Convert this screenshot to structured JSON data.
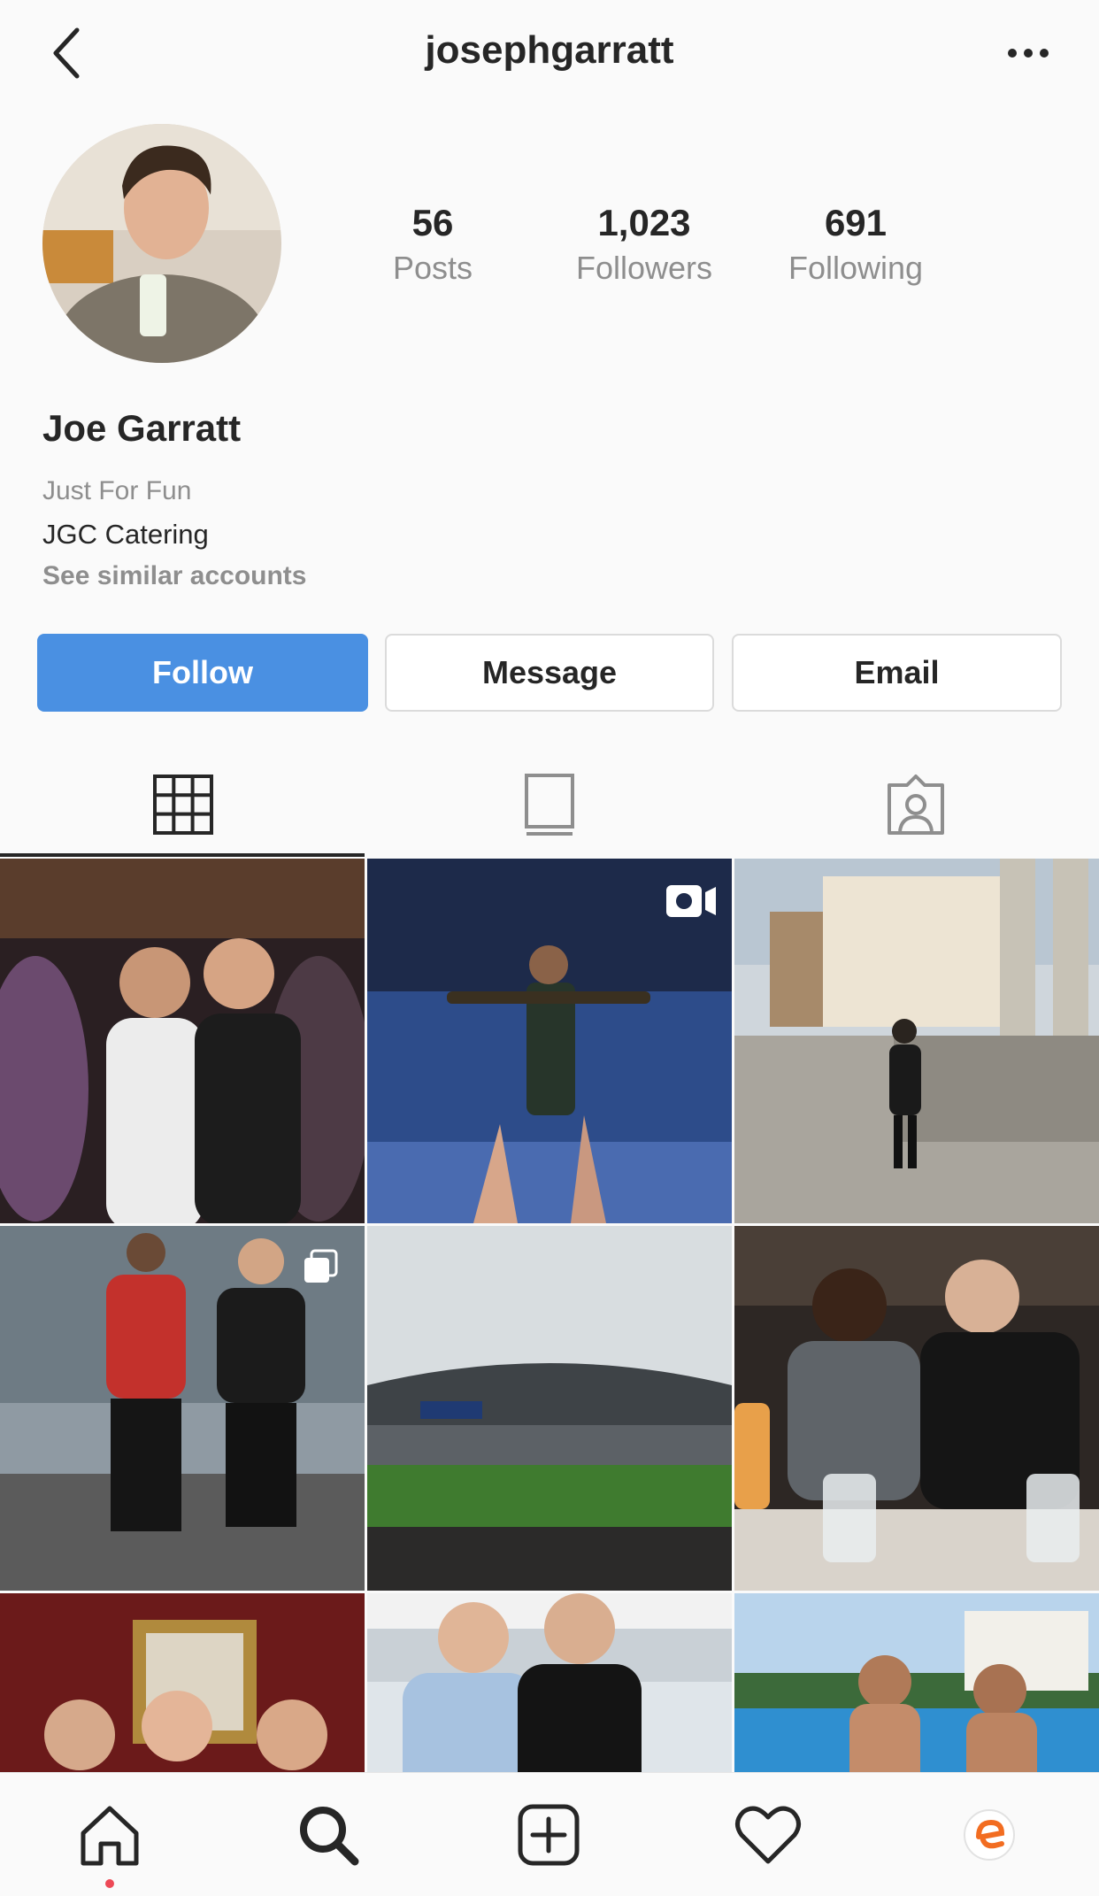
{
  "header": {
    "username": "josephgarratt"
  },
  "stats": [
    {
      "count": "56",
      "label": "Posts"
    },
    {
      "count": "1,023",
      "label": "Followers"
    },
    {
      "count": "691",
      "label": "Following"
    }
  ],
  "profile": {
    "name": "Joe Garratt",
    "category": "Just For Fun",
    "bio": "JGC Catering",
    "similar_link": "See similar accounts"
  },
  "actions": {
    "follow": "Follow",
    "message": "Message",
    "email": "Email"
  },
  "tabs": [
    "grid-icon",
    "igtv-icon",
    "tagged-icon"
  ],
  "colors": {
    "follow_button": "#4a90e2",
    "notification_dot": "#ed4956",
    "secondary_text": "#8e8e8e"
  },
  "posts": [
    {
      "description": "two men posing in a crowded bar",
      "video": false
    },
    {
      "description": "performer on a lit concert stage",
      "video": true
    },
    {
      "description": "woman walking past stone columns in a city square",
      "video": false
    },
    {
      "description": "two men by a fountain",
      "video": false,
      "multiple": true
    },
    {
      "description": "view of a rugby stadium",
      "video": false
    },
    {
      "description": "two men at a restaurant table with glasses",
      "video": false
    },
    {
      "description": "three men in a red pub",
      "video": false
    },
    {
      "description": "two men at a marina with yachts",
      "video": false
    },
    {
      "description": "two men in a swimming pool under palm trees",
      "video": false
    }
  ],
  "bottom_nav": [
    "home-icon",
    "search-icon",
    "new-post-icon",
    "activity-heart-icon",
    "profile-icon"
  ]
}
